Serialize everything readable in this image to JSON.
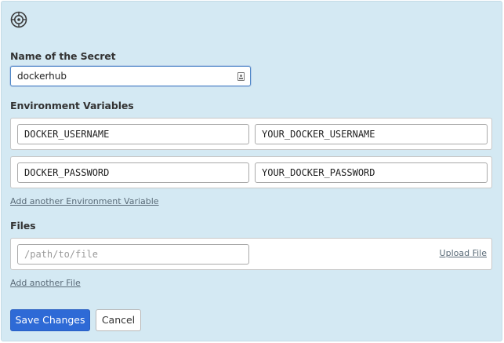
{
  "form": {
    "name_label": "Name of the Secret",
    "name_value": "dockerhub",
    "env_label": "Environment Variables",
    "env_vars": [
      {
        "key": "DOCKER_USERNAME",
        "value": "YOUR_DOCKER_USERNAME"
      },
      {
        "key": "DOCKER_PASSWORD",
        "value": "YOUR_DOCKER_PASSWORD"
      }
    ],
    "add_env_link": "Add another Environment Variable",
    "files_label": "Files",
    "file_path_placeholder": "/path/to/file",
    "upload_link": "Upload File",
    "add_file_link": "Add another File",
    "save_button": "Save Changes",
    "cancel_button": "Cancel"
  },
  "icons": {
    "header_icon": "settings-circle-icon",
    "field_icon": "contact-card-icon"
  }
}
